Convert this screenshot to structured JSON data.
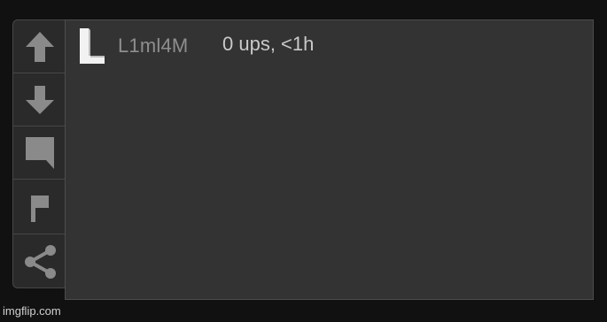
{
  "sidebar": {
    "buttons": [
      {
        "icon": "arrow-up-icon"
      },
      {
        "icon": "arrow-down-icon"
      },
      {
        "icon": "comment-bubble-icon"
      },
      {
        "icon": "flag-icon"
      },
      {
        "icon": "share-icon"
      }
    ],
    "icon_color": "#8a8a8a"
  },
  "comment": {
    "avatar_letter": "L",
    "username": "L1ml4M",
    "meta": "0 ups, <1h"
  },
  "watermark": "imgflip.com",
  "colors": {
    "page_background": "#111111",
    "panel_background": "#333333",
    "sidebar_background": "#2a2a2a",
    "username_color": "#8e8e8e",
    "meta_color": "#c9c9c9"
  }
}
